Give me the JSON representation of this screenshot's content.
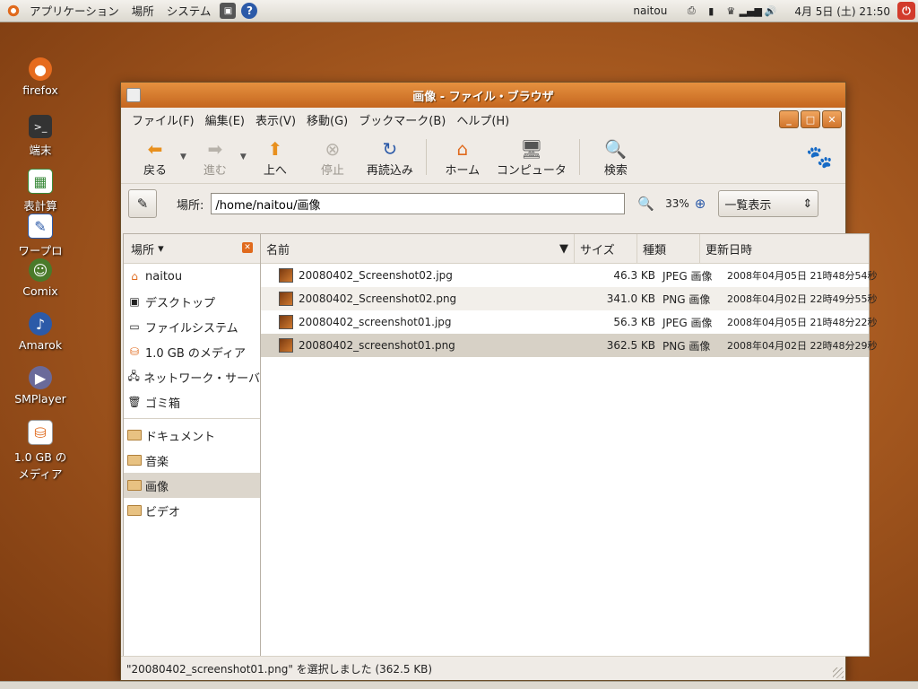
{
  "top_panel": {
    "menus": [
      "アプリケーション",
      "場所",
      "システム"
    ],
    "user": "naitou",
    "clock": "4月 5日 (土) 21:50"
  },
  "desktop_icons": [
    {
      "label": "firefox",
      "icon": "firefox-icon",
      "color": "#e66b1e"
    },
    {
      "label": "端末",
      "icon": "terminal-icon",
      "color": "#333333"
    },
    {
      "label": "表計算",
      "icon": "spreadsheet-icon",
      "color": "#3a8a3a"
    },
    {
      "label": "ワープロ",
      "icon": "wordprocessor-icon",
      "color": "#2c5aa8"
    },
    {
      "label": "Comix",
      "icon": "comix-icon",
      "color": "#4a7a2a"
    },
    {
      "label": "Amarok",
      "icon": "amarok-icon",
      "color": "#2c5aa8"
    },
    {
      "label": "SMPlayer",
      "icon": "smplayer-icon",
      "color": "#6a6a9a"
    },
    {
      "label": "1.0 GB の メディア",
      "icon": "usb-drive-icon",
      "color": "#e06a1d"
    }
  ],
  "window": {
    "title": "画像 - ファイル・ブラウザ",
    "menu": [
      "ファイル(F)",
      "編集(E)",
      "表示(V)",
      "移動(G)",
      "ブックマーク(B)",
      "ヘルプ(H)"
    ],
    "toolbar": {
      "back": "戻る",
      "forward": "進む",
      "up": "上へ",
      "stop": "停止",
      "reload": "再読込み",
      "home": "ホーム",
      "computer": "コンピュータ",
      "search": "検索"
    },
    "location": {
      "label": "場所:",
      "value": "/home/naitou/画像",
      "zoom": "33%",
      "view": "一覧表示"
    },
    "sidebar": {
      "title": "場所",
      "places": [
        {
          "label": "naitou",
          "icon": "home-folder-icon"
        },
        {
          "label": "デスクトップ",
          "icon": "desktop-icon"
        },
        {
          "label": "ファイルシステム",
          "icon": "filesystem-icon"
        },
        {
          "label": "1.0 GB のメディア",
          "icon": "usb-drive-icon"
        },
        {
          "label": "ネットワーク・サーバ",
          "icon": "network-icon"
        },
        {
          "label": "ゴミ箱",
          "icon": "trash-icon"
        }
      ],
      "bookmarks": [
        {
          "label": "ドキュメント"
        },
        {
          "label": "音楽"
        },
        {
          "label": "画像",
          "selected": true
        },
        {
          "label": "ビデオ"
        }
      ]
    },
    "columns": {
      "name": "名前",
      "size": "サイズ",
      "type": "種類",
      "date": "更新日時"
    },
    "files": [
      {
        "name": "20080402_Screenshot02.jpg",
        "size": "46.3 KB",
        "type": "JPEG 画像",
        "date": "2008年04月05日 21時48分54秒"
      },
      {
        "name": "20080402_Screenshot02.png",
        "size": "341.0 KB",
        "type": "PNG 画像",
        "date": "2008年04月02日 22時49分55秒"
      },
      {
        "name": "20080402_screenshot01.jpg",
        "size": "56.3 KB",
        "type": "JPEG 画像",
        "date": "2008年04月05日 21時48分22秒"
      },
      {
        "name": "20080402_screenshot01.png",
        "size": "362.5 KB",
        "type": "PNG 画像",
        "date": "2008年04月02日 22時48分29秒",
        "selected": true
      }
    ],
    "status": "\"20080402_screenshot01.png\" を選択しました (362.5 KB)"
  }
}
